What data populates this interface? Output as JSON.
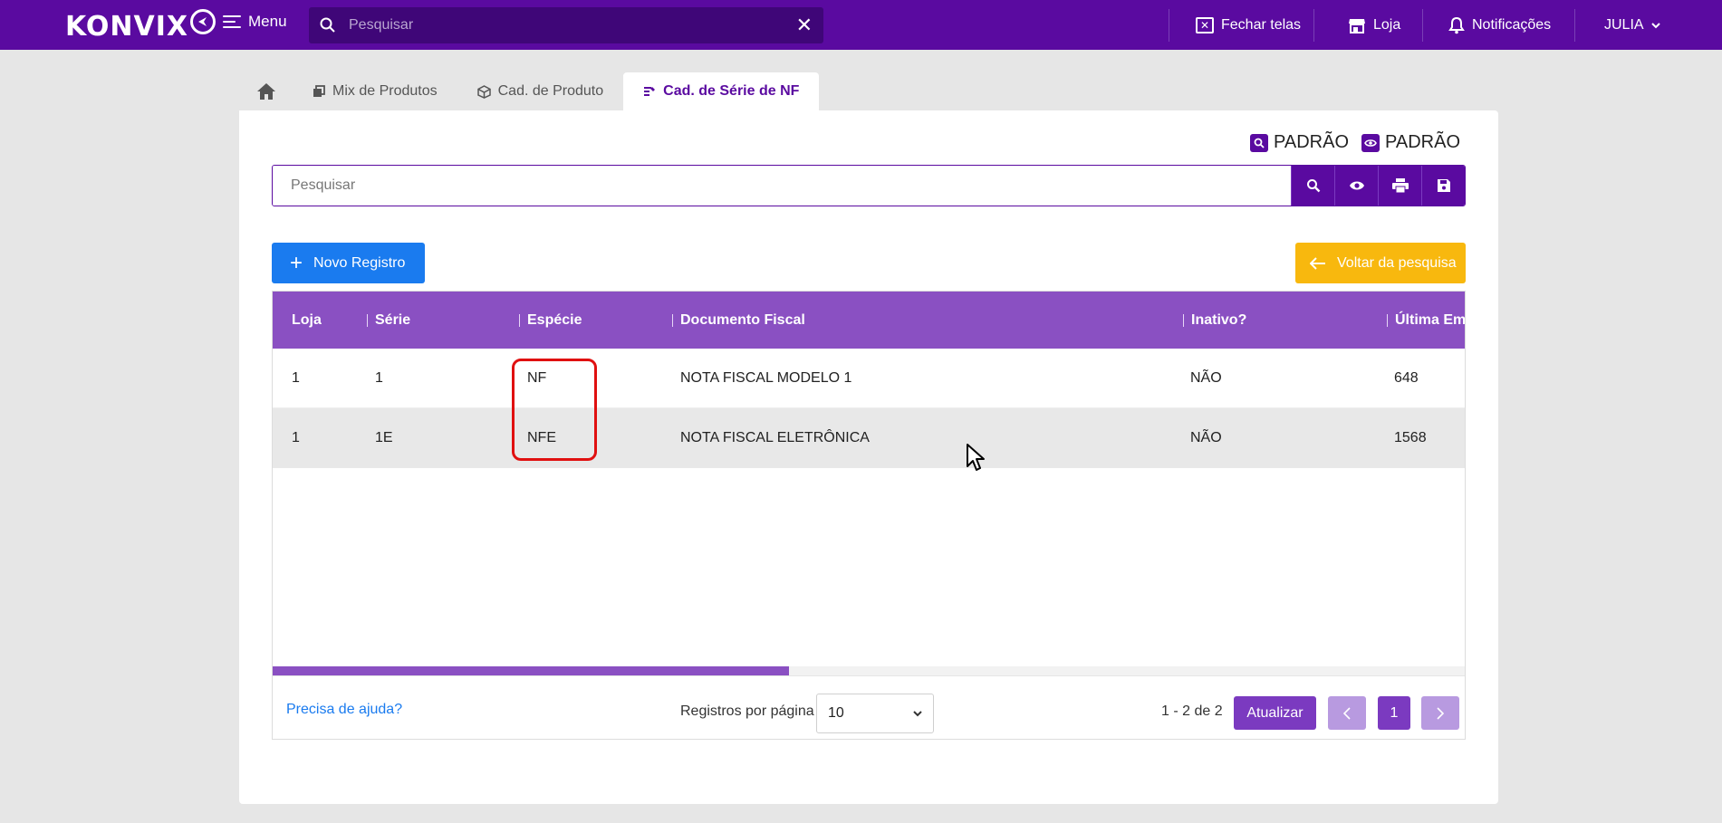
{
  "topbar": {
    "logo": "KONVIX",
    "menu_label": "Menu",
    "search_placeholder": "Pesquisar",
    "close_screens_label": "Fechar telas",
    "store_label": "Loja",
    "notifications_label": "Notificações",
    "user_label": "JULIA"
  },
  "tabs": [
    {
      "label": "Mix de Produtos"
    },
    {
      "label": "Cad. de Produto"
    },
    {
      "label": "Cad. de Série de NF"
    }
  ],
  "filters": {
    "search_filter_label": "PADRÃO",
    "view_filter_label": "PADRÃO"
  },
  "search": {
    "placeholder": "Pesquisar"
  },
  "actions": {
    "new_label": "Novo Registro",
    "back_label": "Voltar da pesquisa"
  },
  "table": {
    "columns": [
      "Loja",
      "Série",
      "Espécie",
      "Documento Fiscal",
      "Inativo?",
      "Última Emi"
    ],
    "rows": [
      [
        "1",
        "1",
        "NF",
        "NOTA FISCAL MODELO 1",
        "NÃO",
        "648"
      ],
      [
        "1",
        "1E",
        "NFE",
        "NOTA FISCAL ELETRÔNICA",
        "NÃO",
        "1568"
      ]
    ]
  },
  "footer": {
    "help_label": "Precisa de ajuda?",
    "per_page_label": "Registros por página",
    "per_page_value": "10",
    "range_label": "1 - 2 de 2",
    "refresh_label": "Atualizar",
    "current_page": "1"
  },
  "colors": {
    "brand_purple": "#5a0aa0",
    "header_purple": "#8a50c2",
    "primary_blue": "#1a7bef",
    "warning_yellow": "#f8b80e",
    "highlight_red": "#e01010"
  }
}
